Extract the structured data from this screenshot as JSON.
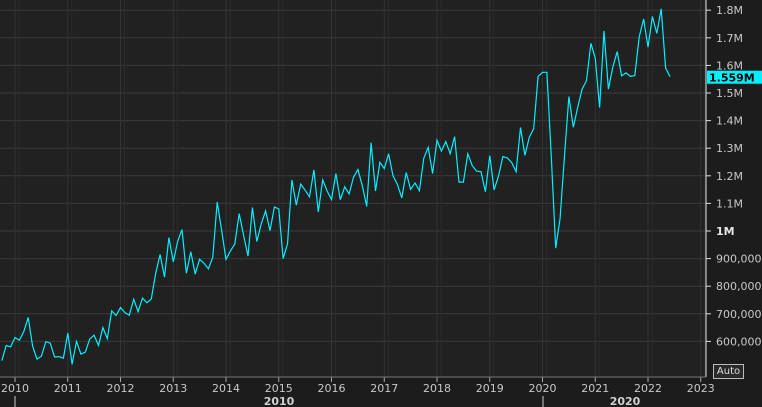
{
  "chart_data": {
    "type": "line",
    "title": "",
    "xlabel": "",
    "ylabel": "",
    "ylim": [
      470000,
      1840000
    ],
    "grid": true,
    "y_axis_side": "right",
    "y_ticks": [
      600000,
      700000,
      800000,
      900000,
      1000000,
      1100000,
      1200000,
      1300000,
      1400000,
      1500000,
      1600000,
      1700000,
      1800000
    ],
    "y_tick_labels": [
      "600,000",
      "700,000",
      "800,000",
      "900,000",
      "1M",
      "1.1M",
      "1.2M",
      "1.3M",
      "1.4M",
      "1.5M",
      "1.6M",
      "1.7M",
      "1.8M"
    ],
    "x_tick_labels": [
      "2010",
      "2011",
      "2012",
      "2013",
      "2014",
      "2015",
      "2016",
      "2017",
      "2018",
      "2019",
      "2020",
      "2021",
      "2022",
      "2023"
    ],
    "decade_labels": [
      "2010",
      "2020"
    ],
    "last_value_label": "1.559M",
    "line_color": "#00f0ff",
    "series": [
      {
        "x": [
          "2009-10",
          "2009-11",
          "2009-12",
          "2010-01",
          "2010-02",
          "2010-03",
          "2010-04",
          "2010-05",
          "2010-06",
          "2010-07",
          "2010-08",
          "2010-09",
          "2010-10",
          "2010-11",
          "2010-12",
          "2011-01",
          "2011-02",
          "2011-03",
          "2011-04",
          "2011-05",
          "2011-06",
          "2011-07",
          "2011-08",
          "2011-09",
          "2011-10",
          "2011-11",
          "2011-12",
          "2012-01",
          "2012-02",
          "2012-03",
          "2012-04",
          "2012-05",
          "2012-06",
          "2012-07",
          "2012-08",
          "2012-09",
          "2012-10",
          "2012-11",
          "2012-12",
          "2013-01",
          "2013-02",
          "2013-03",
          "2013-04",
          "2013-05",
          "2013-06",
          "2013-07",
          "2013-08",
          "2013-09",
          "2013-10",
          "2013-11",
          "2013-12",
          "2014-01",
          "2014-02",
          "2014-03",
          "2014-04",
          "2014-05",
          "2014-06",
          "2014-07",
          "2014-08",
          "2014-09",
          "2014-10",
          "2014-11",
          "2014-12",
          "2015-01",
          "2015-02",
          "2015-03",
          "2015-04",
          "2015-05",
          "2015-06",
          "2015-07",
          "2015-08",
          "2015-09",
          "2015-10",
          "2015-11",
          "2015-12",
          "2016-01",
          "2016-02",
          "2016-03",
          "2016-04",
          "2016-05",
          "2016-06",
          "2016-07",
          "2016-08",
          "2016-09",
          "2016-10",
          "2016-11",
          "2016-12",
          "2017-01",
          "2017-02",
          "2017-03",
          "2017-04",
          "2017-05",
          "2017-06",
          "2017-07",
          "2017-08",
          "2017-09",
          "2017-10",
          "2017-11",
          "2017-12",
          "2018-01",
          "2018-02",
          "2018-03",
          "2018-04",
          "2018-05",
          "2018-06",
          "2018-07",
          "2018-08",
          "2018-09",
          "2018-10",
          "2018-11",
          "2018-12",
          "2019-01",
          "2019-02",
          "2019-03",
          "2019-04",
          "2019-05",
          "2019-06",
          "2019-07",
          "2019-08",
          "2019-09",
          "2019-10",
          "2019-11",
          "2019-12",
          "2020-01",
          "2020-02",
          "2020-03",
          "2020-04",
          "2020-05",
          "2020-06",
          "2020-07",
          "2020-08",
          "2020-09",
          "2020-10",
          "2020-11",
          "2020-12",
          "2021-01",
          "2021-02",
          "2021-03",
          "2021-04",
          "2021-05",
          "2021-06",
          "2021-07",
          "2021-08",
          "2021-09",
          "2021-10",
          "2021-11",
          "2021-12",
          "2022-01",
          "2022-02",
          "2022-03",
          "2022-04",
          "2022-05",
          "2022-06"
        ],
        "values": [
          530000,
          585000,
          580000,
          614000,
          604000,
          636000,
          687000,
          583000,
          536000,
          546000,
          599000,
          594000,
          543000,
          545000,
          539000,
          630000,
          517000,
          600000,
          554000,
          561000,
          608000,
          623000,
          585000,
          650000,
          610000,
          711000,
          694000,
          723000,
          704000,
          695000,
          753000,
          708000,
          757000,
          740000,
          754000,
          847000,
          915000,
          833000,
          976000,
          888000,
          962000,
          1005000,
          847000,
          925000,
          844000,
          898000,
          883000,
          863000,
          905000,
          1105000,
          1003000,
          897000,
          928000,
          953000,
          1063000,
          984000,
          909000,
          1085000,
          962000,
          1025000,
          1073000,
          1001000,
          1087000,
          1080000,
          900000,
          953000,
          1185000,
          1094000,
          1170000,
          1148000,
          1124000,
          1221000,
          1069000,
          1185000,
          1145000,
          1114000,
          1208000,
          1113000,
          1160000,
          1134000,
          1195000,
          1223000,
          1164000,
          1089000,
          1320000,
          1145000,
          1249000,
          1226000,
          1280000,
          1200000,
          1169000,
          1120000,
          1212000,
          1151000,
          1174000,
          1146000,
          1264000,
          1303000,
          1208000,
          1329000,
          1290000,
          1324000,
          1280000,
          1342000,
          1177000,
          1177000,
          1280000,
          1237000,
          1217000,
          1215000,
          1142000,
          1273000,
          1149000,
          1199000,
          1270000,
          1265000,
          1248000,
          1215000,
          1375000,
          1274000,
          1340000,
          1371000,
          1560000,
          1575000,
          1575000,
          1269000,
          938000,
          1046000,
          1273000,
          1487000,
          1376000,
          1448000,
          1514000,
          1545000,
          1680000,
          1625000,
          1447000,
          1725000,
          1514000,
          1594000,
          1650000,
          1562000,
          1573000,
          1560000,
          1563000,
          1703000,
          1768000,
          1666000,
          1777000,
          1716000,
          1805000,
          1591000,
          1559000
        ]
      }
    ]
  },
  "controls": {
    "auto_label": "Auto"
  }
}
